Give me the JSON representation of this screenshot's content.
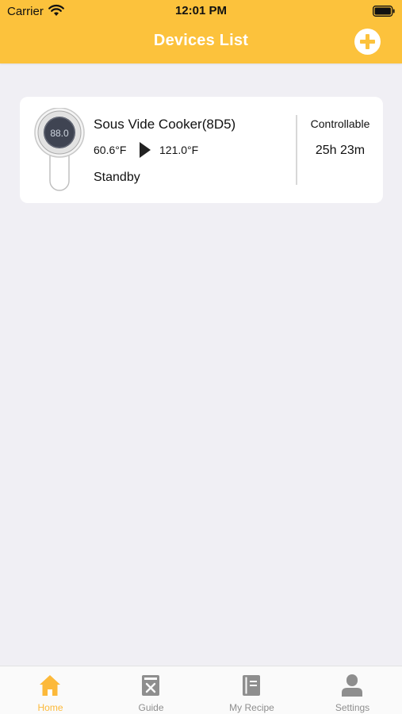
{
  "status_bar": {
    "carrier": "Carrier",
    "time": "12:01 PM"
  },
  "header": {
    "title": "Devices List",
    "add_icon": "plus-circle-icon"
  },
  "device": {
    "name": "Sous Vide Cooker(8D5)",
    "display_reading": "88.0",
    "current_temp": "60.6°F",
    "target_temp": "121.0°F",
    "status": "Standby",
    "control": "Controllable",
    "time_remaining": "25h 23m"
  },
  "tabs": [
    {
      "label": "Home",
      "icon": "home-icon",
      "active": true
    },
    {
      "label": "Guide",
      "icon": "guide-book-icon",
      "active": false
    },
    {
      "label": "My Recipe",
      "icon": "recipe-book-icon",
      "active": false
    },
    {
      "label": "Settings",
      "icon": "user-settings-icon",
      "active": false
    }
  ],
  "colors": {
    "accent": "#fcc23c",
    "background": "#f0eff4",
    "inactive": "#8e8e8e",
    "active_tab": "#fcb93a"
  }
}
